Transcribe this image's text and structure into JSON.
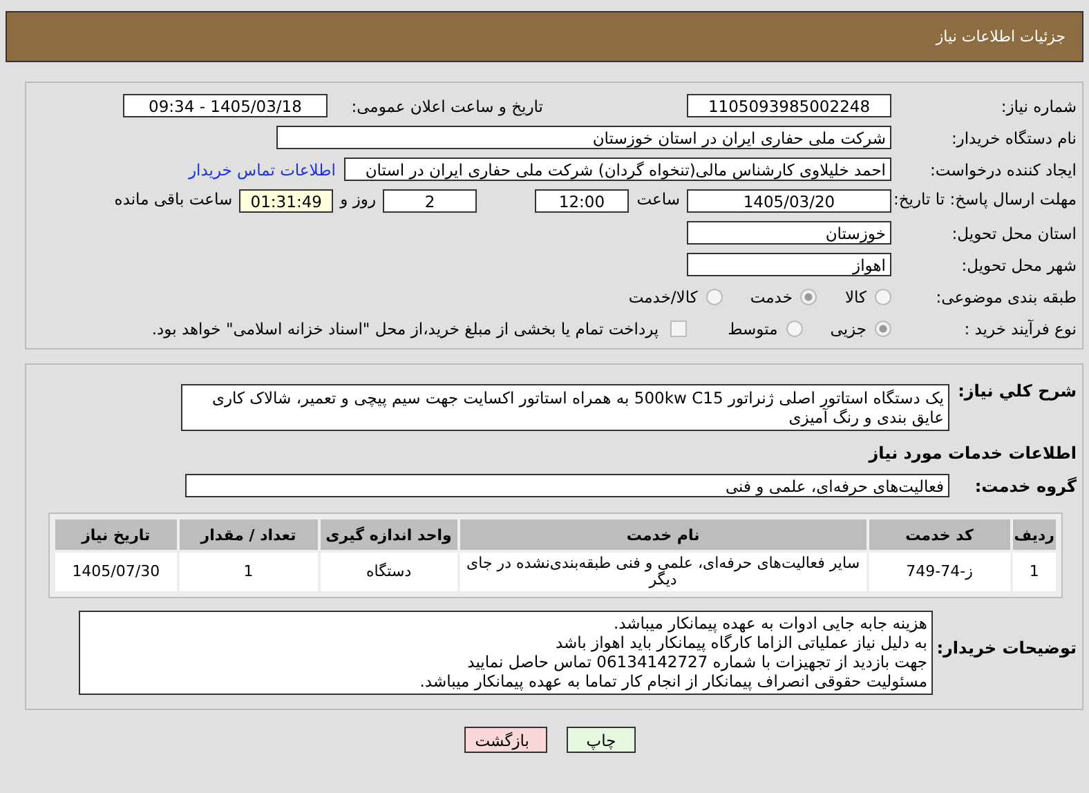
{
  "header": {
    "title": "جزئیات اطلاعات نیاز"
  },
  "need_number": {
    "label": "شماره نیاز:",
    "value": "1105093985002248"
  },
  "announce": {
    "label": "تاریخ و ساعت اعلان عمومی:",
    "value": "1405/03/18 - 09:34"
  },
  "buyer": {
    "label": "نام دستگاه خریدار:",
    "value": "شرکت ملی حفاری ایران در استان خوزستان"
  },
  "requester": {
    "label": "ایجاد کننده درخواست:",
    "value": "احمد خلیلاوی کارشناس مالی(تنخواه گردان) شرکت ملی حفاری ایران در استان",
    "link": "اطلاعات تماس خریدار"
  },
  "deadline": {
    "label": "مهلت ارسال پاسخ: تا تاریخ:",
    "date": "1405/03/20",
    "time_label": "ساعت",
    "time": "12:00",
    "days": "2",
    "days_label": "روز و",
    "remaining": "01:31:49",
    "remaining_label": "ساعت باقی مانده"
  },
  "province": {
    "label": "استان محل تحویل:",
    "value": "خوزستان"
  },
  "city": {
    "label": "شهر محل تحویل:",
    "value": "اهواز"
  },
  "category": {
    "label": "طبقه بندی موضوعی:",
    "options": [
      {
        "label": "کالا",
        "selected": false
      },
      {
        "label": "خدمت",
        "selected": true
      },
      {
        "label": "کالا/خدمت",
        "selected": false
      }
    ]
  },
  "process": {
    "label": "نوع فرآیند خرید :",
    "options": [
      {
        "label": "جزیی",
        "selected": true
      },
      {
        "label": "متوسط",
        "selected": false
      }
    ],
    "payment": {
      "checked": false,
      "label": "پرداخت تمام یا بخشی از مبلغ خرید،از محل \"اسناد خزانه اسلامی\" خواهد بود."
    }
  },
  "description": {
    "label": "شرح کلي نياز:",
    "value": "یک دستگاه استاتور اصلی ژنراتور 500kw C15  به همراه استاتور اکسایت جهت سیم پیچی و تعمیر، شالاک کاری عایق بندی و رنگ آمیزی"
  },
  "services_title": "اطلاعات خدمات مورد نياز",
  "service_group": {
    "label": "گروه خدمت:",
    "value": "فعالیت‌های حرفه‌ای، علمی و فنی"
  },
  "table": {
    "columns": [
      "ردیف",
      "کد خدمت",
      "نام خدمت",
      "واحد اندازه گیری",
      "تعداد / مقدار",
      "تاریخ نیاز"
    ],
    "rows": [
      [
        "1",
        "ز-74-749",
        "سایر فعالیت‌های حرفه‌ای، علمی و فنی طبقه‌بندی‌نشده در جای دیگر",
        "دستگاه",
        "1",
        "1405/07/30"
      ]
    ]
  },
  "buyer_notes": {
    "label": "توضیحات خریدار:",
    "lines": [
      "هزینه جابه جایی ادوات به عهده پیمانکار میباشد.",
      "به دلیل نیاز عملیاتی الزاما کارگاه پیمانکار باید اهواز باشد",
      "جهت بازدید از تجهیزات با شماره 06134142727 تماس حاصل نمایید",
      "مسئولیت حقوقی انصراف پیمانکار از انجام کار تماما به عهده پیمانکار میباشد."
    ]
  },
  "buttons": [
    {
      "label": "چاپ",
      "kind": "print"
    },
    {
      "label": "بازگشت",
      "kind": "back"
    }
  ]
}
